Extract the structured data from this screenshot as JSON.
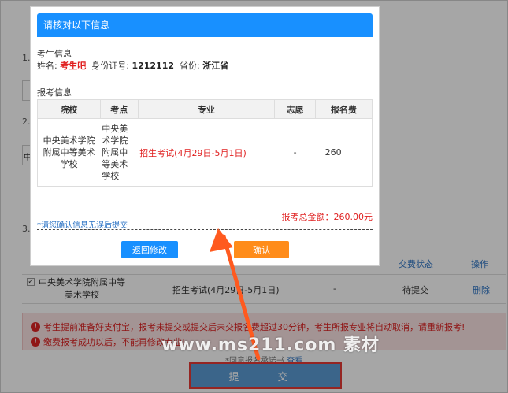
{
  "background": {
    "steps": [
      "1.",
      "2.",
      "3."
    ],
    "box_text": "中",
    "table_headers": {
      "status": "交费状态",
      "action": "操作"
    },
    "row": {
      "school": "中央美术学院附属中等美术学校",
      "major": "招生考试(4月29日-5月1日)",
      "wish": "-",
      "status": "待提交",
      "delete": "删除"
    },
    "warnings": [
      "考生提前准备好支付宝，报考未提交或提交后未交报名费超过30分钟，考生所报专业将自动取消，请重新报考!",
      "缴费报考成功以后，不能再修改专业!"
    ],
    "agree_text": "*同意报名承诺书",
    "agree_link": "查看",
    "submit_label": "提　交"
  },
  "modal": {
    "title": "请核对以下信息",
    "student_section": "考生信息",
    "student": {
      "name_label": "姓名:",
      "name": "考生吧",
      "id_label": "身份证号:",
      "id": "1212112",
      "province_label": "省份:",
      "province": "浙江省"
    },
    "reg_section": "报考信息",
    "columns": [
      "院校",
      "考点",
      "专业",
      "志愿",
      "报名费"
    ],
    "rows": [
      {
        "school": "中央美术学院附属中等美术学校",
        "site": "中央美术学院附属中等美术学校",
        "major": "招生考试(4月29日-5月1日)",
        "wish": "-",
        "fee": "260"
      }
    ],
    "total": "报考总金额：260.00元",
    "confirm_tip": "*请您确认信息无误后提交",
    "back_label": "返回修改",
    "ok_label": "确认"
  },
  "watermark": "www.ms211.com 素材",
  "colors": {
    "accent": "#1890ff",
    "confirm": "#ff8c1a",
    "warning": "#e02020",
    "arrow": "#ff5a1f"
  }
}
